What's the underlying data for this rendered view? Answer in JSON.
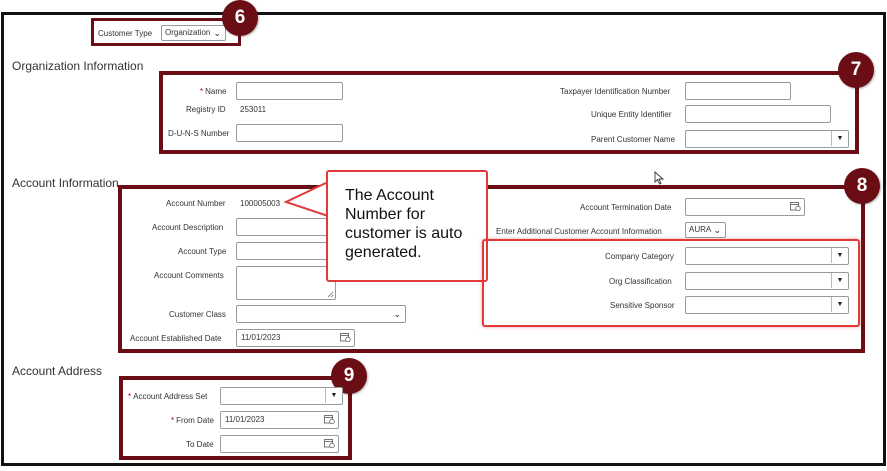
{
  "customer_type": {
    "label": "Customer Type",
    "value": "Organization"
  },
  "organization_info": {
    "title": "Organization Information",
    "name_label": "Name",
    "registry_id_label": "Registry ID",
    "registry_id_value": "253011",
    "duns_label": "D-U-N-S Number",
    "taxpayer_label": "Taxpayer Identification Number",
    "uei_label": "Unique Entity Identifier",
    "parent_label": "Parent Customer Name"
  },
  "account_info": {
    "title": "Account Information",
    "account_number_label": "Account Number",
    "account_number_value": "100005003",
    "description_label": "Account Description",
    "type_label": "Account Type",
    "comments_label": "Account Comments",
    "customer_class_label": "Customer Class",
    "established_label": "Account Established Date",
    "established_value": "11/01/2023",
    "termination_label": "Account Termination Date",
    "additional_info_label": "Enter Additional Customer Account Information",
    "additional_info_value": "AURA",
    "company_category_label": "Company Category",
    "org_classification_label": "Org Classification",
    "sensitive_sponsor_label": "Sensitive Sponsor"
  },
  "account_address": {
    "title": "Account Address",
    "address_set_label": "Account Address Set",
    "from_date_label": "From Date",
    "from_date_value": "11/01/2023",
    "to_date_label": "To Date"
  },
  "callout": {
    "text": "The Account Number for customer is auto generated."
  },
  "badges": {
    "b6": "6",
    "b7": "7",
    "b8": "8",
    "b9": "9"
  },
  "colors": {
    "highlight": "#6b0d14",
    "callout_border": "#e03a3a",
    "group_border": "#e03a3a"
  }
}
